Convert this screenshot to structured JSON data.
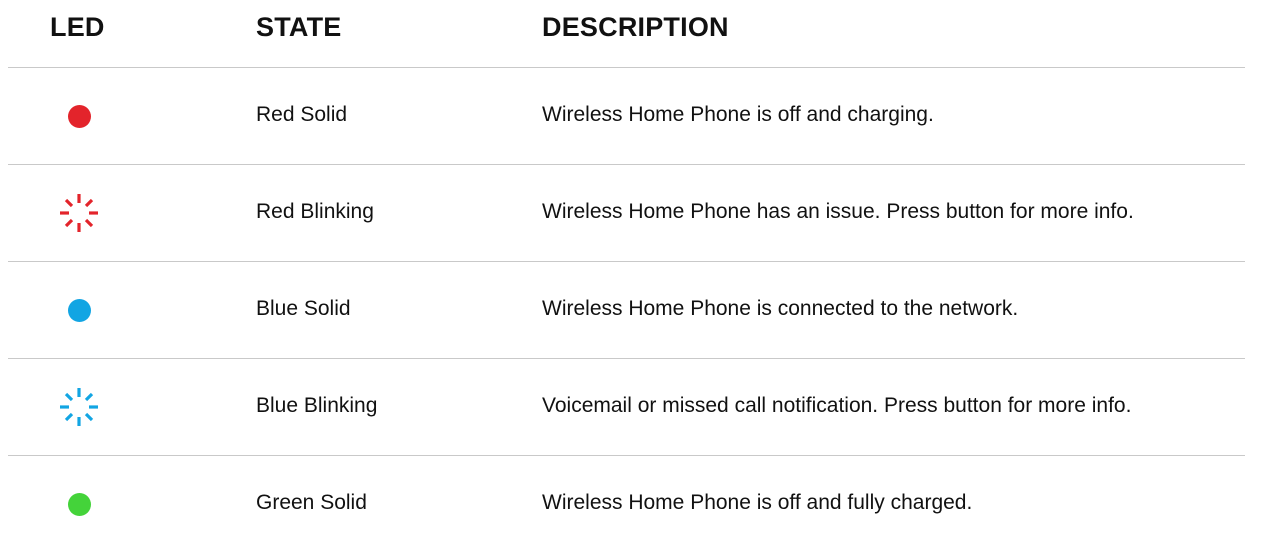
{
  "headers": {
    "led": "LED",
    "state": "STATE",
    "description": "DESCRIPTION"
  },
  "rows": [
    {
      "led_icon": "solid-dot-icon",
      "color": "#e3242b",
      "state": "Red Solid",
      "description": "Wireless Home Phone is off and charging."
    },
    {
      "led_icon": "blinking-icon",
      "color": "#e3242b",
      "state": "Red Blinking",
      "description": "Wireless Home Phone has an issue. Press button for more info."
    },
    {
      "led_icon": "solid-dot-icon",
      "color": "#12a5e3",
      "state": "Blue Solid",
      "description": "Wireless Home Phone is connected to the network."
    },
    {
      "led_icon": "blinking-icon",
      "color": "#12a5e3",
      "state": "Blue Blinking",
      "description": "Voicemail or missed call notification. Press button for more info."
    },
    {
      "led_icon": "solid-dot-icon",
      "color": "#44d33a",
      "state": "Green Solid",
      "description": "Wireless Home Phone is off and fully charged."
    }
  ]
}
